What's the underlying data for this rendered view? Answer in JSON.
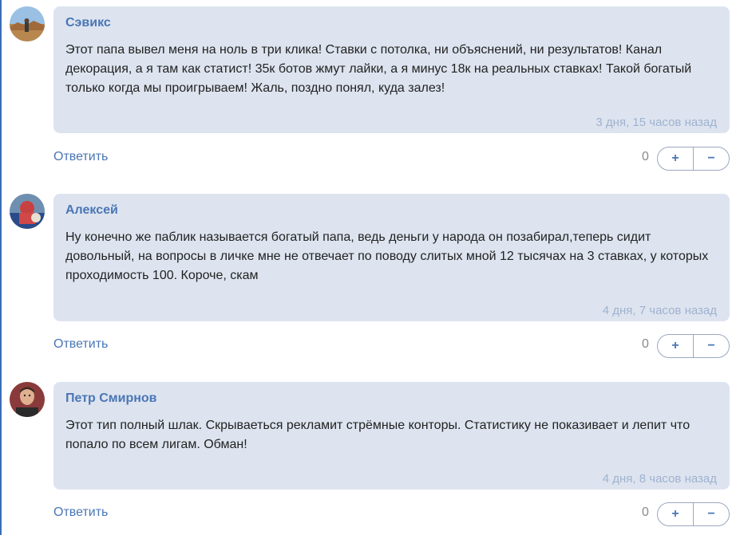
{
  "comments": [
    {
      "author": "Сэвикс",
      "text": "Этот папа вывел меня на ноль в три клика! Ставки с потолка, ни объяснений, ни результатов! Канал декорация, а я там как статист! 35к ботов жмут лайки, а я минус 18к на реальных ставках! Такой богатый только когда мы проигрываем! Жаль, поздно понял, куда залез!",
      "time": "3 дня, 15 часов назад",
      "reply": "Ответить",
      "score": "0",
      "up": "+",
      "down": "−"
    },
    {
      "author": "Алексей",
      "text": "Ну конечно же паблик называется богатый папа, ведь деньги у народа он позабирал,теперь сидит довольный, на вопросы в личке мне не отвечает по поводу слитых мной 12 тысячах на 3 ставках, у которых проходимость 100. Короче, скам",
      "time": "4 дня, 7 часов назад",
      "reply": "Ответить",
      "score": "0",
      "up": "+",
      "down": "−"
    },
    {
      "author": "Петр Смирнов",
      "text": "Этот тип полный шлак. Скрываеться рекламит стрёмные конторы. Статистику не показивает и лепит что попало по всем лигам. Обман!",
      "time": "4 дня, 8 часов назад",
      "reply": "Ответить",
      "score": "0",
      "up": "+",
      "down": "−"
    }
  ]
}
